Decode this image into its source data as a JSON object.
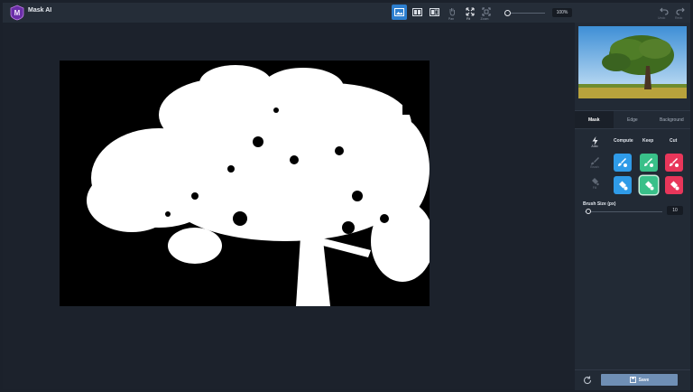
{
  "app": {
    "title": "Mask AI"
  },
  "toolbar": {
    "view_buttons": [
      {
        "name": "view-mask-only",
        "active": true
      },
      {
        "name": "view-side-by-side",
        "active": false
      },
      {
        "name": "view-overlay",
        "active": false
      }
    ],
    "pan_label": "Pan",
    "fit_label": "Fit",
    "zoom_tool_label": "Zoom",
    "zoom_value": "100%",
    "undo_label": "Undo",
    "redo_label": "Redo"
  },
  "panel": {
    "tabs": [
      {
        "label": "Mask",
        "active": true
      },
      {
        "label": "Edge",
        "active": false
      },
      {
        "label": "Background",
        "active": false
      }
    ],
    "side_tools": {
      "auto_label": "Auto",
      "brush_label": "Brush",
      "fill_label": "Fill"
    },
    "columns": [
      "Compute",
      "Keep",
      "Cut"
    ],
    "brush_size_label": "Brush Size (px)",
    "brush_size_value": "10",
    "brush_size_fraction": 0.04,
    "save_label": "Save"
  },
  "colors": {
    "accent_blue": "#2f9be8",
    "keep_green": "#39c089",
    "cut_red": "#e8365a",
    "active_view": "#2d7fcf",
    "save_button": "#6f8fb5"
  },
  "icons": [
    "app-logo-icon",
    "pan-icon",
    "fit-icon",
    "zoom-icon",
    "undo-icon",
    "redo-icon",
    "lightning-icon",
    "brush-icon",
    "paint-bucket-icon",
    "reset-icon",
    "save-icon"
  ]
}
